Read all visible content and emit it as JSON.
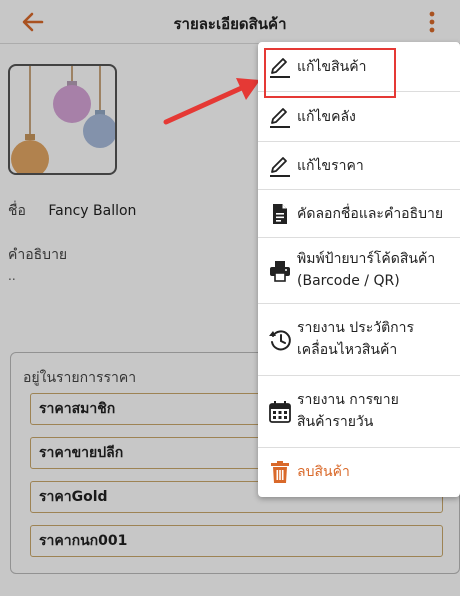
{
  "header": {
    "title": "รายละเอียดสินค้า"
  },
  "product": {
    "name_label": "ชื่อ",
    "name_value": "Fancy Ballon",
    "desc_label": "คำอธิบาย",
    "desc_value": ".."
  },
  "price_list": {
    "title": "อยู่ในรายการราคา",
    "items": [
      "ราคาสมาชิก",
      "ราคาขายปลีก",
      "ราคาGold",
      "ราคากนก001"
    ]
  },
  "menu": {
    "items": [
      {
        "label": "แก้ไขสินค้า",
        "icon": "pencil-icon"
      },
      {
        "label": "แก้ไขคลัง",
        "icon": "pencil-icon"
      },
      {
        "label": "แก้ไขราคา",
        "icon": "pencil-icon"
      },
      {
        "label": "คัดลอกชื่อและคำอธิบาย",
        "icon": "document-icon"
      },
      {
        "label_line1": "พิมพ์ป้ายบาร์โค้ดสินค้า",
        "label_line2": "(Barcode / QR)",
        "icon": "printer-icon"
      },
      {
        "label_line1": "รายงาน ประวัติการ",
        "label_line2": "เคลื่อนไหวสินค้า",
        "icon": "history-icon"
      },
      {
        "label_line1": "รายงาน การขาย",
        "label_line2": "สินค้ารายวัน",
        "icon": "calendar-icon"
      },
      {
        "label": "ลบสินค้า",
        "icon": "trash-icon"
      }
    ]
  },
  "colors": {
    "accent": "#d9692a",
    "highlight": "#e53935"
  }
}
